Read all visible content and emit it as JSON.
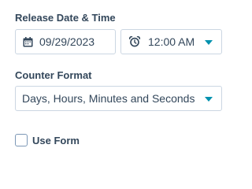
{
  "release": {
    "label": "Release Date & Time",
    "date_value": "09/29/2023",
    "date_icon": "calendar-icon",
    "time_value": "12:00 AM",
    "time_icon": "alarm-clock-icon"
  },
  "counter_format": {
    "label": "Counter Format",
    "selected": "Days, Hours, Minutes and Seconds"
  },
  "use_form": {
    "label": "Use Form",
    "checked": false
  },
  "colors": {
    "text": "#33475b",
    "border": "#cbd6e2",
    "accent": "#0091ae",
    "checkbox_border": "#7c98b6"
  }
}
